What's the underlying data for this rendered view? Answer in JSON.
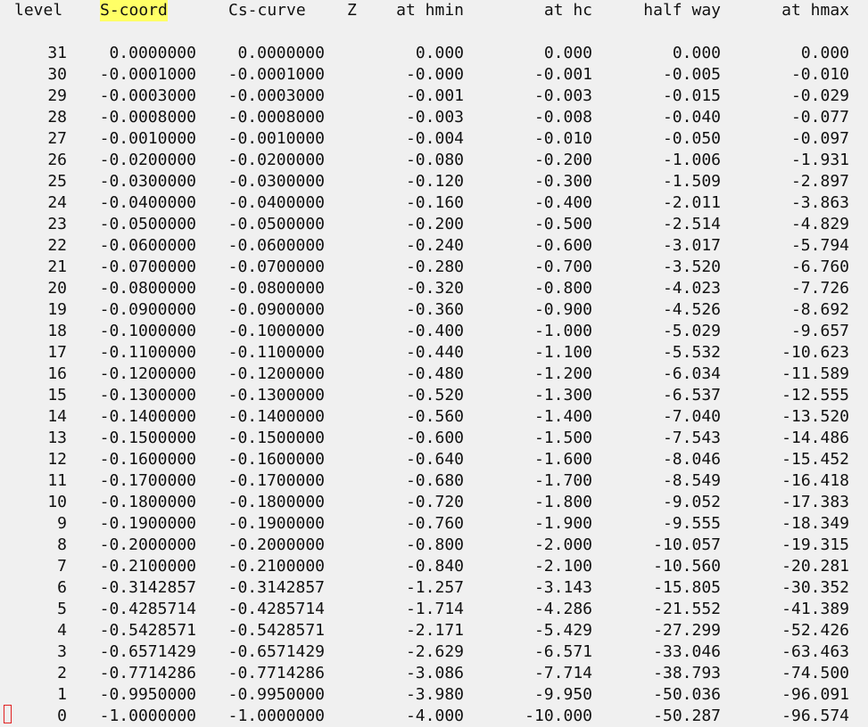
{
  "headers": {
    "level": "level",
    "s_coord": "S-coord",
    "cs_curve": "Cs-curve",
    "z": "Z",
    "at_hmin": "at hmin",
    "at_hc": "at hc",
    "half_way": "half way",
    "at_hmax": "at hmax"
  },
  "highlight_color": "#ffff66",
  "rows": [
    {
      "level": "31",
      "s": "0.0000000",
      "cs": "0.0000000",
      "hmin": "0.000",
      "hc": "0.000",
      "half": "0.000",
      "hmax": "0.000"
    },
    {
      "level": "30",
      "s": "-0.0001000",
      "cs": "-0.0001000",
      "hmin": "-0.000",
      "hc": "-0.001",
      "half": "-0.005",
      "hmax": "-0.010"
    },
    {
      "level": "29",
      "s": "-0.0003000",
      "cs": "-0.0003000",
      "hmin": "-0.001",
      "hc": "-0.003",
      "half": "-0.015",
      "hmax": "-0.029"
    },
    {
      "level": "28",
      "s": "-0.0008000",
      "cs": "-0.0008000",
      "hmin": "-0.003",
      "hc": "-0.008",
      "half": "-0.040",
      "hmax": "-0.077"
    },
    {
      "level": "27",
      "s": "-0.0010000",
      "cs": "-0.0010000",
      "hmin": "-0.004",
      "hc": "-0.010",
      "half": "-0.050",
      "hmax": "-0.097"
    },
    {
      "level": "26",
      "s": "-0.0200000",
      "cs": "-0.0200000",
      "hmin": "-0.080",
      "hc": "-0.200",
      "half": "-1.006",
      "hmax": "-1.931"
    },
    {
      "level": "25",
      "s": "-0.0300000",
      "cs": "-0.0300000",
      "hmin": "-0.120",
      "hc": "-0.300",
      "half": "-1.509",
      "hmax": "-2.897"
    },
    {
      "level": "24",
      "s": "-0.0400000",
      "cs": "-0.0400000",
      "hmin": "-0.160",
      "hc": "-0.400",
      "half": "-2.011",
      "hmax": "-3.863"
    },
    {
      "level": "23",
      "s": "-0.0500000",
      "cs": "-0.0500000",
      "hmin": "-0.200",
      "hc": "-0.500",
      "half": "-2.514",
      "hmax": "-4.829"
    },
    {
      "level": "22",
      "s": "-0.0600000",
      "cs": "-0.0600000",
      "hmin": "-0.240",
      "hc": "-0.600",
      "half": "-3.017",
      "hmax": "-5.794"
    },
    {
      "level": "21",
      "s": "-0.0700000",
      "cs": "-0.0700000",
      "hmin": "-0.280",
      "hc": "-0.700",
      "half": "-3.520",
      "hmax": "-6.760"
    },
    {
      "level": "20",
      "s": "-0.0800000",
      "cs": "-0.0800000",
      "hmin": "-0.320",
      "hc": "-0.800",
      "half": "-4.023",
      "hmax": "-7.726"
    },
    {
      "level": "19",
      "s": "-0.0900000",
      "cs": "-0.0900000",
      "hmin": "-0.360",
      "hc": "-0.900",
      "half": "-4.526",
      "hmax": "-8.692"
    },
    {
      "level": "18",
      "s": "-0.1000000",
      "cs": "-0.1000000",
      "hmin": "-0.400",
      "hc": "-1.000",
      "half": "-5.029",
      "hmax": "-9.657"
    },
    {
      "level": "17",
      "s": "-0.1100000",
      "cs": "-0.1100000",
      "hmin": "-0.440",
      "hc": "-1.100",
      "half": "-5.532",
      "hmax": "-10.623"
    },
    {
      "level": "16",
      "s": "-0.1200000",
      "cs": "-0.1200000",
      "hmin": "-0.480",
      "hc": "-1.200",
      "half": "-6.034",
      "hmax": "-11.589"
    },
    {
      "level": "15",
      "s": "-0.1300000",
      "cs": "-0.1300000",
      "hmin": "-0.520",
      "hc": "-1.300",
      "half": "-6.537",
      "hmax": "-12.555"
    },
    {
      "level": "14",
      "s": "-0.1400000",
      "cs": "-0.1400000",
      "hmin": "-0.560",
      "hc": "-1.400",
      "half": "-7.040",
      "hmax": "-13.520"
    },
    {
      "level": "13",
      "s": "-0.1500000",
      "cs": "-0.1500000",
      "hmin": "-0.600",
      "hc": "-1.500",
      "half": "-7.543",
      "hmax": "-14.486"
    },
    {
      "level": "12",
      "s": "-0.1600000",
      "cs": "-0.1600000",
      "hmin": "-0.640",
      "hc": "-1.600",
      "half": "-8.046",
      "hmax": "-15.452"
    },
    {
      "level": "11",
      "s": "-0.1700000",
      "cs": "-0.1700000",
      "hmin": "-0.680",
      "hc": "-1.700",
      "half": "-8.549",
      "hmax": "-16.418"
    },
    {
      "level": "10",
      "s": "-0.1800000",
      "cs": "-0.1800000",
      "hmin": "-0.720",
      "hc": "-1.800",
      "half": "-9.052",
      "hmax": "-17.383"
    },
    {
      "level": "9",
      "s": "-0.1900000",
      "cs": "-0.1900000",
      "hmin": "-0.760",
      "hc": "-1.900",
      "half": "-9.555",
      "hmax": "-18.349"
    },
    {
      "level": "8",
      "s": "-0.2000000",
      "cs": "-0.2000000",
      "hmin": "-0.800",
      "hc": "-2.000",
      "half": "-10.057",
      "hmax": "-19.315"
    },
    {
      "level": "7",
      "s": "-0.2100000",
      "cs": "-0.2100000",
      "hmin": "-0.840",
      "hc": "-2.100",
      "half": "-10.560",
      "hmax": "-20.281"
    },
    {
      "level": "6",
      "s": "-0.3142857",
      "cs": "-0.3142857",
      "hmin": "-1.257",
      "hc": "-3.143",
      "half": "-15.805",
      "hmax": "-30.352"
    },
    {
      "level": "5",
      "s": "-0.4285714",
      "cs": "-0.4285714",
      "hmin": "-1.714",
      "hc": "-4.286",
      "half": "-21.552",
      "hmax": "-41.389"
    },
    {
      "level": "4",
      "s": "-0.5428571",
      "cs": "-0.5428571",
      "hmin": "-2.171",
      "hc": "-5.429",
      "half": "-27.299",
      "hmax": "-52.426"
    },
    {
      "level": "3",
      "s": "-0.6571429",
      "cs": "-0.6571429",
      "hmin": "-2.629",
      "hc": "-6.571",
      "half": "-33.046",
      "hmax": "-63.463"
    },
    {
      "level": "2",
      "s": "-0.7714286",
      "cs": "-0.7714286",
      "hmin": "-3.086",
      "hc": "-7.714",
      "half": "-38.793",
      "hmax": "-74.500"
    },
    {
      "level": "1",
      "s": "-0.9950000",
      "cs": "-0.9950000",
      "hmin": "-3.980",
      "hc": "-9.950",
      "half": "-50.036",
      "hmax": "-96.091"
    },
    {
      "level": "0",
      "s": "-1.0000000",
      "cs": "-1.0000000",
      "hmin": "-4.000",
      "hc": "-10.000",
      "half": "-50.287",
      "hmax": "-96.574"
    }
  ]
}
